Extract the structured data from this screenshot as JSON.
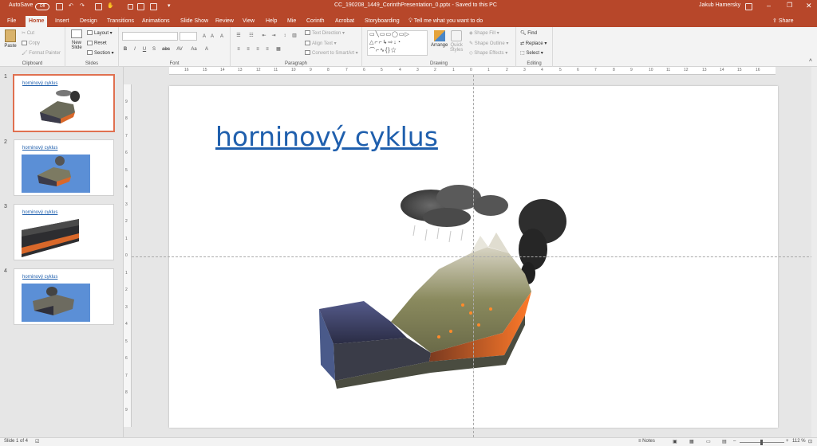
{
  "titlebar": {
    "autosave_label": "AutoSave",
    "autosave_state": "Off",
    "document_title": "CC_190208_1449_CorinthPresentation_0.pptx  -  Saved to this PC",
    "user_name": "Jakub Hamersky",
    "window_buttons": [
      "minimize",
      "restore",
      "close"
    ]
  },
  "ribbon_tabs": [
    "File",
    "Home",
    "Insert",
    "Design",
    "Transitions",
    "Animations",
    "Slide Show",
    "Review",
    "View",
    "Help",
    "Mie",
    "Corinth",
    "Acrobat",
    "Storyboarding"
  ],
  "active_tab": "Home",
  "tell_me": "Tell me what you want to do",
  "share_label": "Share",
  "ribbon": {
    "clipboard": {
      "paste": "Paste",
      "cut": "Cut",
      "copy": "Copy",
      "format_painter": "Format Painter",
      "label": "Clipboard"
    },
    "slides": {
      "new_slide": "New",
      "new_slide2": "Slide",
      "layout": "Layout",
      "reset": "Reset",
      "section": "Section",
      "label": "Slides"
    },
    "font": {
      "label": "Font",
      "bold": "B",
      "italic": "I",
      "underline": "U",
      "strike": "S",
      "shadow": "abc",
      "spacing": "AV",
      "case": "Aa"
    },
    "paragraph": {
      "label": "Paragraph",
      "text_direction": "Text Direction",
      "align_text": "Align Text",
      "smartart": "Convert to SmartArt"
    },
    "drawing": {
      "label": "Drawing",
      "arrange": "Arrange",
      "quick_styles": "Quick",
      "quick_styles2": "Styles",
      "shape_fill": "Shape Fill",
      "shape_outline": "Shape Outline",
      "shape_effects": "Shape Effects"
    },
    "editing": {
      "label": "Editing",
      "find": "Find",
      "replace": "Replace",
      "select": "Select"
    }
  },
  "slides": [
    {
      "number": "1",
      "title": "horninový cyklus",
      "selected": true
    },
    {
      "number": "2",
      "title": "horninový cyklus",
      "selected": false
    },
    {
      "number": "3",
      "title": "horninový cyklus",
      "selected": false
    },
    {
      "number": "4",
      "title": "horninový cyklus",
      "selected": false
    }
  ],
  "main_slide": {
    "title": "horninový cyklus",
    "image": "volcano-cross-section-illustration"
  },
  "ruler": {
    "labels": [
      "16",
      "15",
      "14",
      "13",
      "12",
      "11",
      "10",
      "9",
      "8",
      "7",
      "6",
      "5",
      "4",
      "3",
      "2",
      "1",
      "0",
      "1",
      "2",
      "3",
      "4",
      "5",
      "6",
      "7",
      "8",
      "9",
      "10",
      "11",
      "12",
      "13",
      "14",
      "15",
      "16"
    ],
    "vlabels": [
      "9",
      "8",
      "7",
      "6",
      "5",
      "4",
      "3",
      "2",
      "1",
      "0",
      "1",
      "2",
      "3",
      "4",
      "5",
      "6",
      "7",
      "8",
      "9"
    ]
  },
  "statusbar": {
    "slide_info": "Slide 1 of 4",
    "notes": "Notes",
    "zoom": "112 %"
  },
  "colors": {
    "accent": "#b7472a",
    "link": "#1f5fad"
  }
}
